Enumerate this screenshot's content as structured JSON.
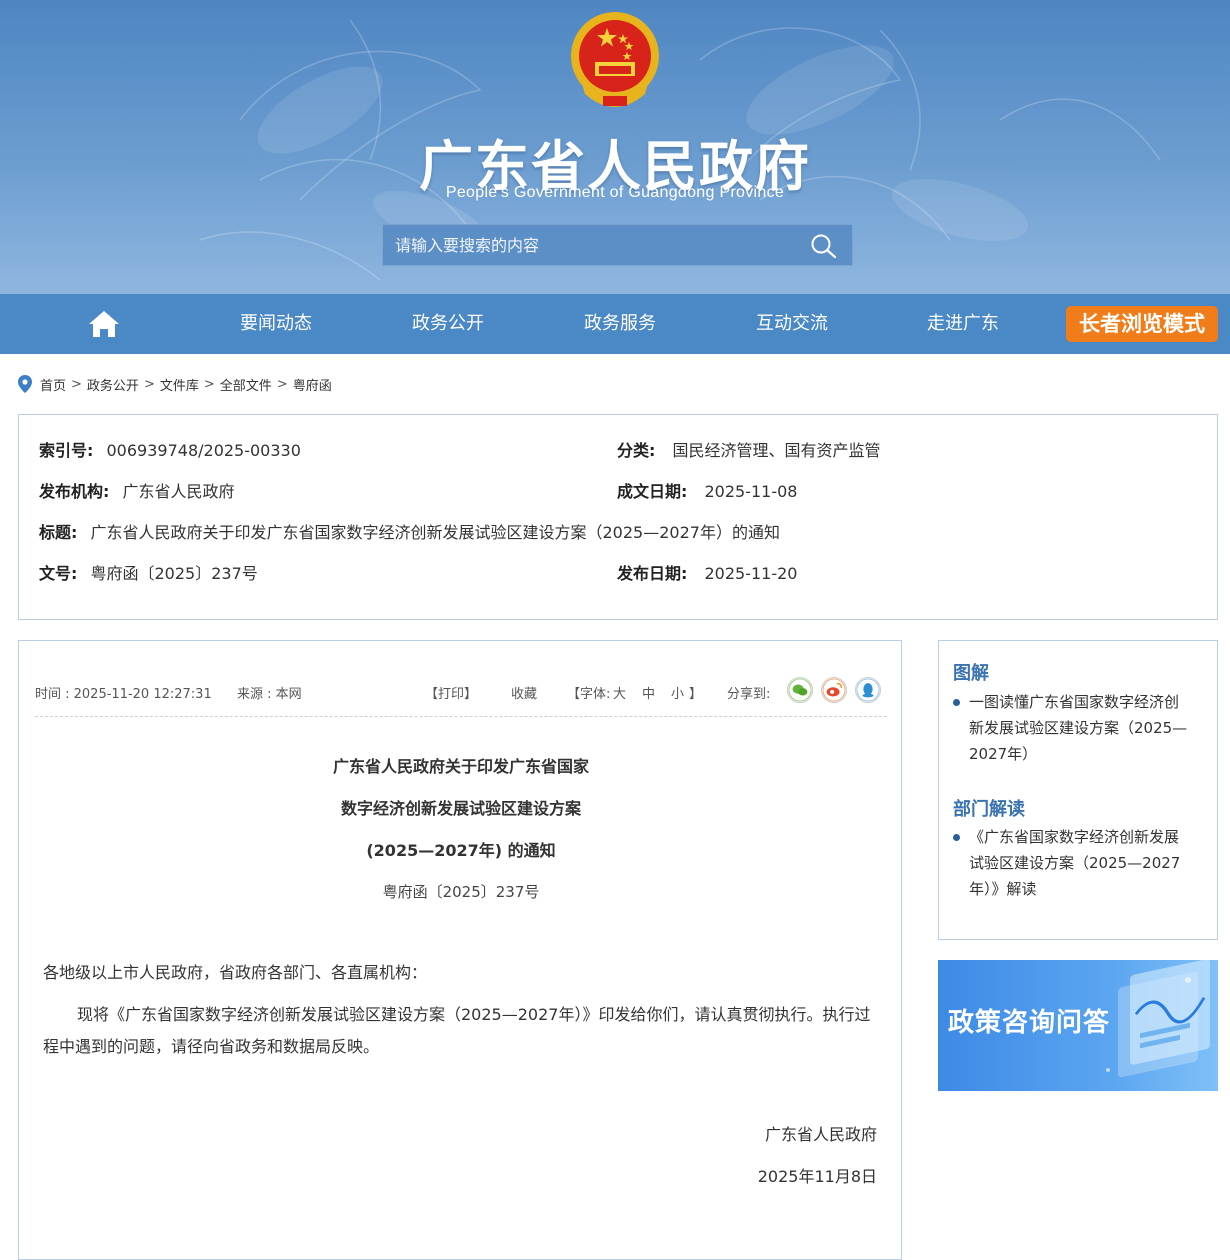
{
  "header": {
    "title": "广东省人民政府",
    "subtitle": "People's Government of Guangdong Province",
    "search_placeholder": "请输入要搜索的内容"
  },
  "nav": {
    "items": [
      "要闻动态",
      "政务公开",
      "政务服务",
      "互动交流",
      "走进广东"
    ],
    "elder_mode": "长者浏览模式"
  },
  "breadcrumb": [
    "首页",
    "政务公开",
    "文件库",
    "全部文件",
    "粤府函"
  ],
  "meta": {
    "index_label": "索引号:",
    "index_value": "006939748/2025-00330",
    "category_label": "分类:",
    "category_value": "国民经济管理、国有资产监管",
    "publisher_label": "发布机构:",
    "publisher_value": "广东省人民政府",
    "written_label": "成文日期:",
    "written_value": "2025-11-08",
    "title_label": "标题:",
    "title_value": "广东省人民政府关于印发广东省国家数字经济创新发展试验区建设方案（2025—2027年）的通知",
    "docno_label": "文号:",
    "docno_value": "粤府函〔2025〕237号",
    "pubdate_label": "发布日期:",
    "pubdate_value": "2025-11-20"
  },
  "toolbar": {
    "time": "时间 : 2025-11-20 12:27:31",
    "source": "来源 : 本网",
    "print": "【打印】",
    "favorite": "收藏",
    "font_prefix": "【字体:",
    "font_large": "大",
    "font_medium": "中",
    "font_small": "小",
    "font_suffix": "】",
    "share_label": "分享到:"
  },
  "document": {
    "title_line1": "广东省人民政府关于印发广东省国家",
    "title_line2": "数字经济创新发展试验区建设方案",
    "title_line3": "(2025—2027年) 的通知",
    "number": "粤府函〔2025〕237号",
    "salutation": "各地级以上市人民政府，省政府各部门、各直属机构：",
    "body_line1": "现将《广东省国家数字经济创新发展试验区建设方案（2025—2027年）》印发给你们，请认真贯彻执行。执行过",
    "body_line2": "程中遇到的问题，请径向省政务和数据局反映。",
    "sign_org": "广东省人民政府",
    "sign_date": "2025年11月8日"
  },
  "sidebar": {
    "section1_title": "图解",
    "section1_line1": "一图读懂广东省国家数字经济创",
    "section1_line2": "新发展试验区建设方案（2025—",
    "section1_line3": "2027年）",
    "section2_title": "部门解读",
    "section2_line1": "《广东省国家数字经济创新发展",
    "section2_line2": "试验区建设方案（2025—2027",
    "section2_line3": "年）》解读",
    "banner": "政策咨询问答"
  },
  "colors": {
    "header_blue": "#4f86c2",
    "nav_blue": "#4a88c6",
    "elder_orange": "#f07d1a",
    "link_blue": "#3a73b0"
  },
  "icons": [
    "emblem",
    "search-icon",
    "home-icon",
    "location-pin-icon",
    "wechat-icon",
    "weibo-icon",
    "qq-icon"
  ]
}
